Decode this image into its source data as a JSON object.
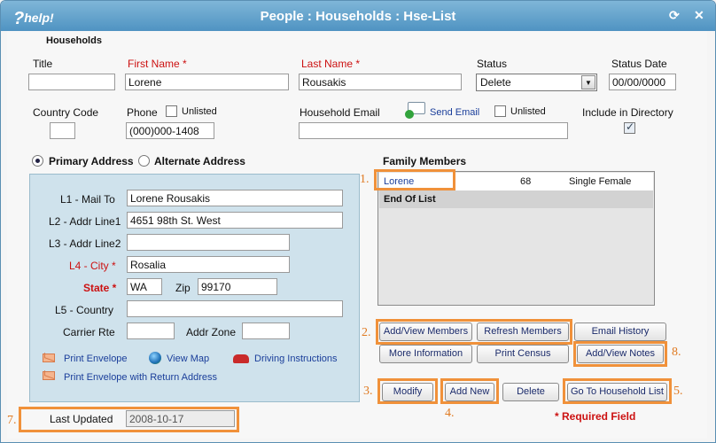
{
  "window": {
    "title": "People : Households : Hse-List",
    "help_label": "help!",
    "help_q": "?"
  },
  "section_title": "Households",
  "fields": {
    "title": {
      "label": "Title",
      "value": ""
    },
    "first_name": {
      "label": "First Name *",
      "value": "Lorene"
    },
    "last_name": {
      "label": "Last Name *",
      "value": "Rousakis"
    },
    "status": {
      "label": "Status",
      "value": "Delete"
    },
    "status_date": {
      "label": "Status Date",
      "value": "00/00/0000"
    },
    "country_code": {
      "label": "Country Code",
      "value": ""
    },
    "phone": {
      "label": "Phone",
      "value": "(000)000-1408",
      "unlisted_label": "Unlisted"
    },
    "household_email": {
      "label": "Household Email",
      "value": "",
      "send_email_label": "Send Email",
      "unlisted_label": "Unlisted"
    },
    "include_in_directory": {
      "label": "Include in Directory",
      "checked": true
    }
  },
  "address": {
    "primary_label": "Primary Address",
    "alternate_label": "Alternate Address",
    "l1": {
      "label": "L1 - Mail To",
      "value": "Lorene Rousakis"
    },
    "l2": {
      "label": "L2 - Addr Line1",
      "value": "4651 98th St. West"
    },
    "l3": {
      "label": "L3 - Addr Line2",
      "value": ""
    },
    "l4": {
      "label": "L4 - City *",
      "value": "Rosalia"
    },
    "state": {
      "label": "State *",
      "value": "WA"
    },
    "zip": {
      "label": "Zip",
      "value": "99170"
    },
    "l5": {
      "label": "L5 - Country",
      "value": ""
    },
    "carrier_rte": {
      "label": "Carrier Rte",
      "value": ""
    },
    "addr_zone": {
      "label": "Addr Zone",
      "value": ""
    },
    "links": {
      "print_envelope": "Print Envelope",
      "view_map": "View Map",
      "driving_instructions": "Driving Instructions",
      "print_envelope_return": "Print Envelope with Return Address"
    }
  },
  "family": {
    "title": "Family Members",
    "members": [
      {
        "name": "Lorene",
        "age": "68",
        "status": "Single Female"
      }
    ],
    "end_label": "End Of List"
  },
  "buttons": {
    "add_view_members": "Add/View Members",
    "refresh_members": "Refresh Members",
    "email_history": "Email History",
    "more_information": "More Information",
    "print_census": "Print Census",
    "add_view_notes": "Add/View Notes",
    "modify": "Modify",
    "add_new": "Add New",
    "delete": "Delete",
    "go_to_household_list": "Go To Household List"
  },
  "required_field_note": "* Required Field",
  "last_updated": {
    "label": "Last Updated",
    "value": "2008-10-17"
  },
  "callouts": [
    "1.",
    "2.",
    "3.",
    "4.",
    "5.",
    "7.",
    "8."
  ],
  "colors": {
    "highlight": "#f0913a",
    "required": "#cc1111",
    "titlebar": "#5a9ac8"
  }
}
